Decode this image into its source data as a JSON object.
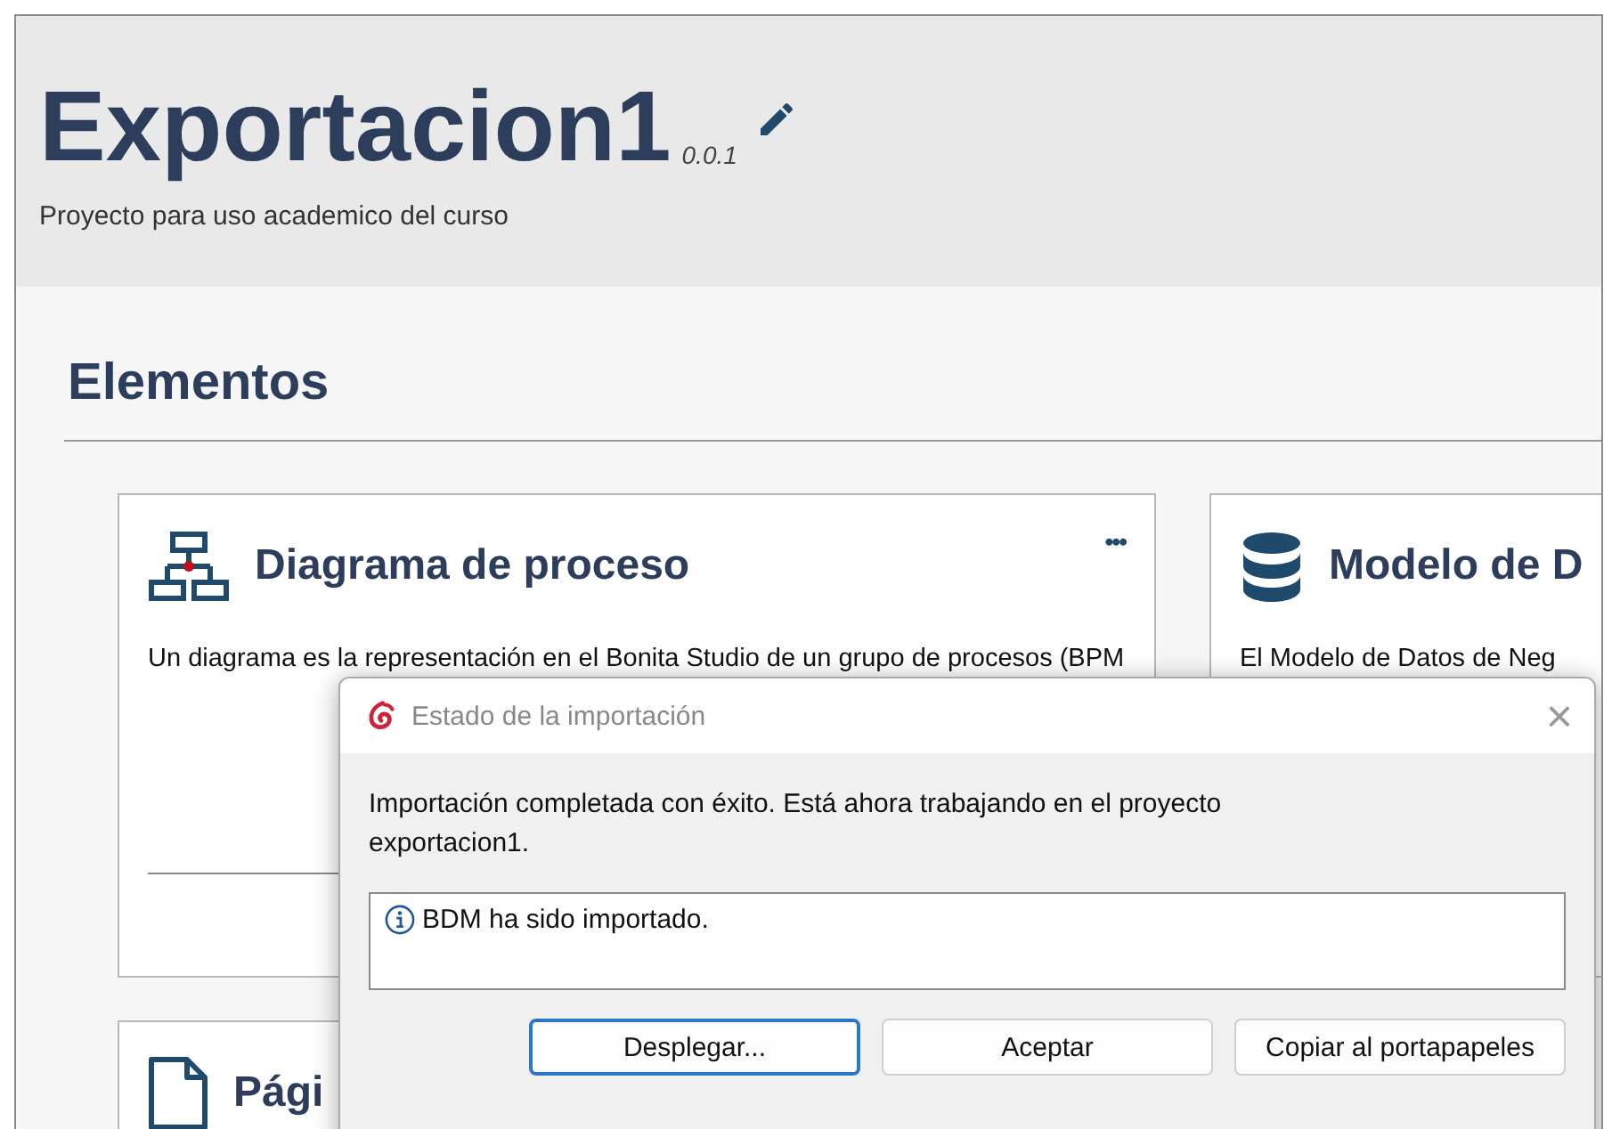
{
  "project": {
    "title": "Exportacion1",
    "version": "0.0.1",
    "description": "Proyecto para uso academico del curso"
  },
  "section": {
    "title": "Elementos"
  },
  "cards": [
    {
      "kind": "diagram",
      "title": "Diagrama de proceso",
      "menu": "•••",
      "description": "Un diagrama es la representación en el Bonita Studio de un grupo de procesos (BPM"
    },
    {
      "kind": "database",
      "title": "Modelo de D",
      "description": "El Modelo de Datos de Neg"
    },
    {
      "kind": "page",
      "title": "Pági"
    }
  ],
  "dialog": {
    "title": "Estado de la importación",
    "close": "×",
    "message": "Importación completada con éxito. Está ahora trabajando en el proyecto exportacion1.",
    "details": "BDM ha sido importado.",
    "buttons": [
      {
        "label": "Desplegar...",
        "focused": true
      },
      {
        "label": "Aceptar",
        "focused": false
      },
      {
        "label": "Copiar al portapapeles",
        "focused": false
      }
    ]
  }
}
